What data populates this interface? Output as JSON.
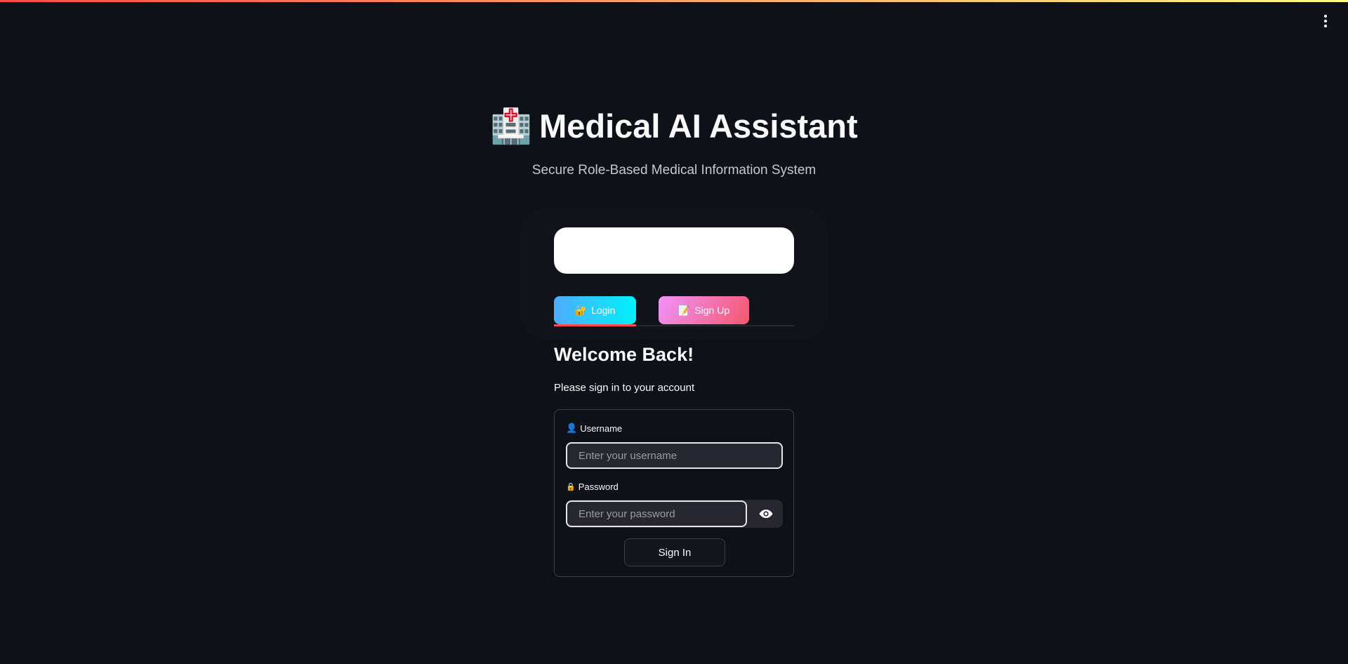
{
  "header": {
    "title": "Medical AI Assistant",
    "title_icon": "🏥",
    "subtitle": "Secure Role-Based Medical Information System",
    "menu_icon": "vertical-ellipsis-icon"
  },
  "tabs": [
    {
      "label": "Login",
      "icon": "🔐",
      "active": true
    },
    {
      "label": "Sign Up",
      "icon": "📝",
      "active": false
    }
  ],
  "login": {
    "heading": "Welcome Back!",
    "subheading": "Please sign in to your account",
    "username_label": "Username",
    "username_icon": "👤",
    "username_placeholder": "Enter your username",
    "username_value": "",
    "password_label": "Password",
    "password_icon": "🔒",
    "password_placeholder": "Enter your password",
    "password_value": "",
    "submit_label": "Sign In"
  },
  "colors": {
    "background": "#0e1117",
    "accent": "#ff4b4b"
  }
}
